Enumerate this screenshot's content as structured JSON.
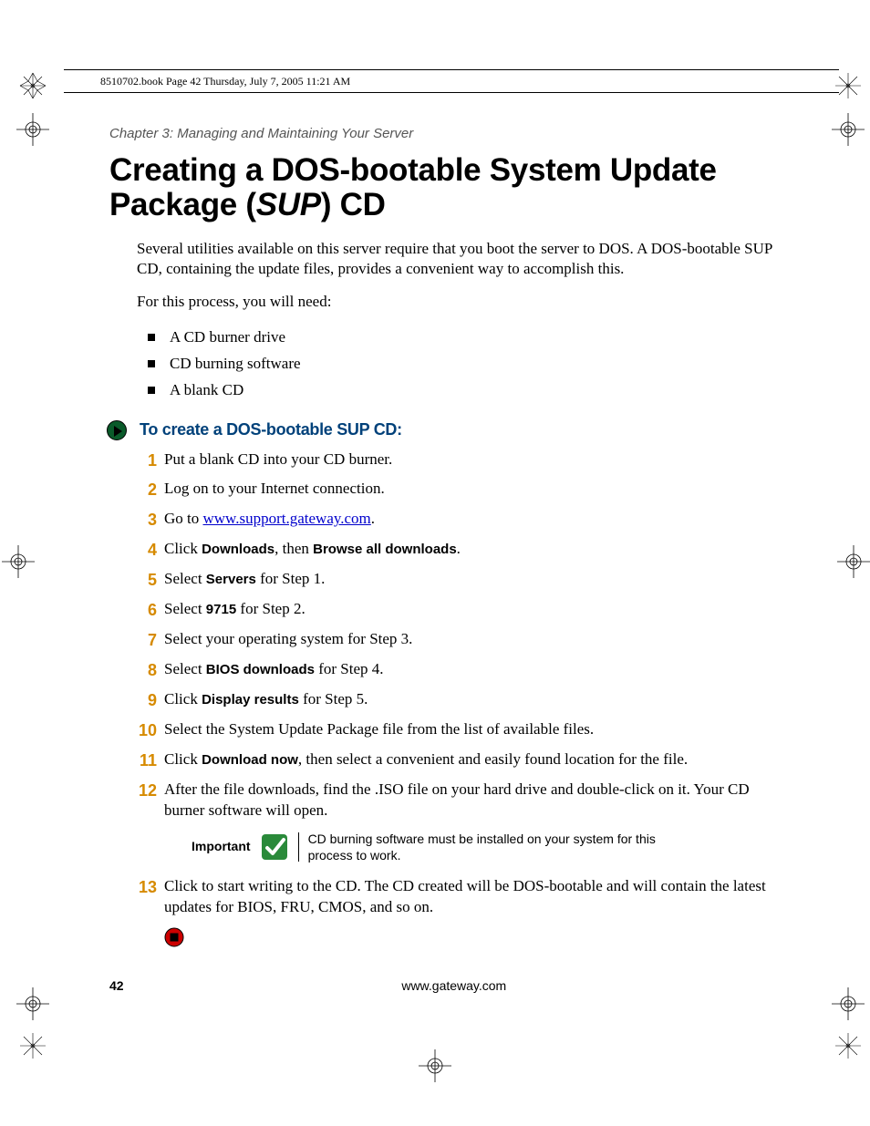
{
  "book_header": "8510702.book  Page 42  Thursday, July 7, 2005  11:21 AM",
  "chapter": "Chapter 3: Managing and Maintaining Your Server",
  "title_pre": "Creating a DOS-bootable System Update Package (",
  "title_italic": "SUP",
  "title_post": ") CD",
  "intro": "Several utilities available on this server require that you boot the server to DOS. A DOS-bootable SUP CD, containing the update files, provides a convenient way to accomplish this.",
  "need_intro": "For this process, you will need:",
  "needs": [
    "A CD burner drive",
    "CD burning software",
    "A blank CD"
  ],
  "proc_heading": "To create a DOS-bootable SUP CD:",
  "steps": {
    "s1": "Put a blank CD into your CD burner.",
    "s2": "Log on to your Internet connection.",
    "s3_pre": "Go to ",
    "s3_link": "www.support.gateway.com",
    "s3_post": ".",
    "s4_a": "Click ",
    "s4_b": "Downloads",
    "s4_c": ", then ",
    "s4_d": "Browse all downloads",
    "s4_e": ".",
    "s5_a": "Select ",
    "s5_b": "Servers",
    "s5_c": " for Step 1.",
    "s6_a": "Select ",
    "s6_b": "9715",
    "s6_c": " for Step 2.",
    "s7": "Select your operating system for Step 3.",
    "s8_a": "Select ",
    "s8_b": "BIOS downloads",
    "s8_c": " for Step 4.",
    "s9_a": "Click ",
    "s9_b": "Display results",
    "s9_c": " for Step 5.",
    "s10": "Select the System Update Package file from the list of available files.",
    "s11_a": "Click ",
    "s11_b": "Download now",
    "s11_c": ", then select a convenient and easily found location for the file.",
    "s12": "After the file downloads, find the .ISO file on your hard drive and double-click on it. Your CD burner software will open.",
    "s13": "Click to start writing to the CD. The CD created will be DOS-bootable and will contain the latest updates for BIOS, FRU, CMOS, and so on."
  },
  "step_nums": [
    "1",
    "2",
    "3",
    "4",
    "5",
    "6",
    "7",
    "8",
    "9",
    "10",
    "11",
    "12",
    "13"
  ],
  "important_label": "Important",
  "important_text": "CD burning software must be installed on your system for this process to work.",
  "page_number": "42",
  "footer_url": "www.gateway.com"
}
